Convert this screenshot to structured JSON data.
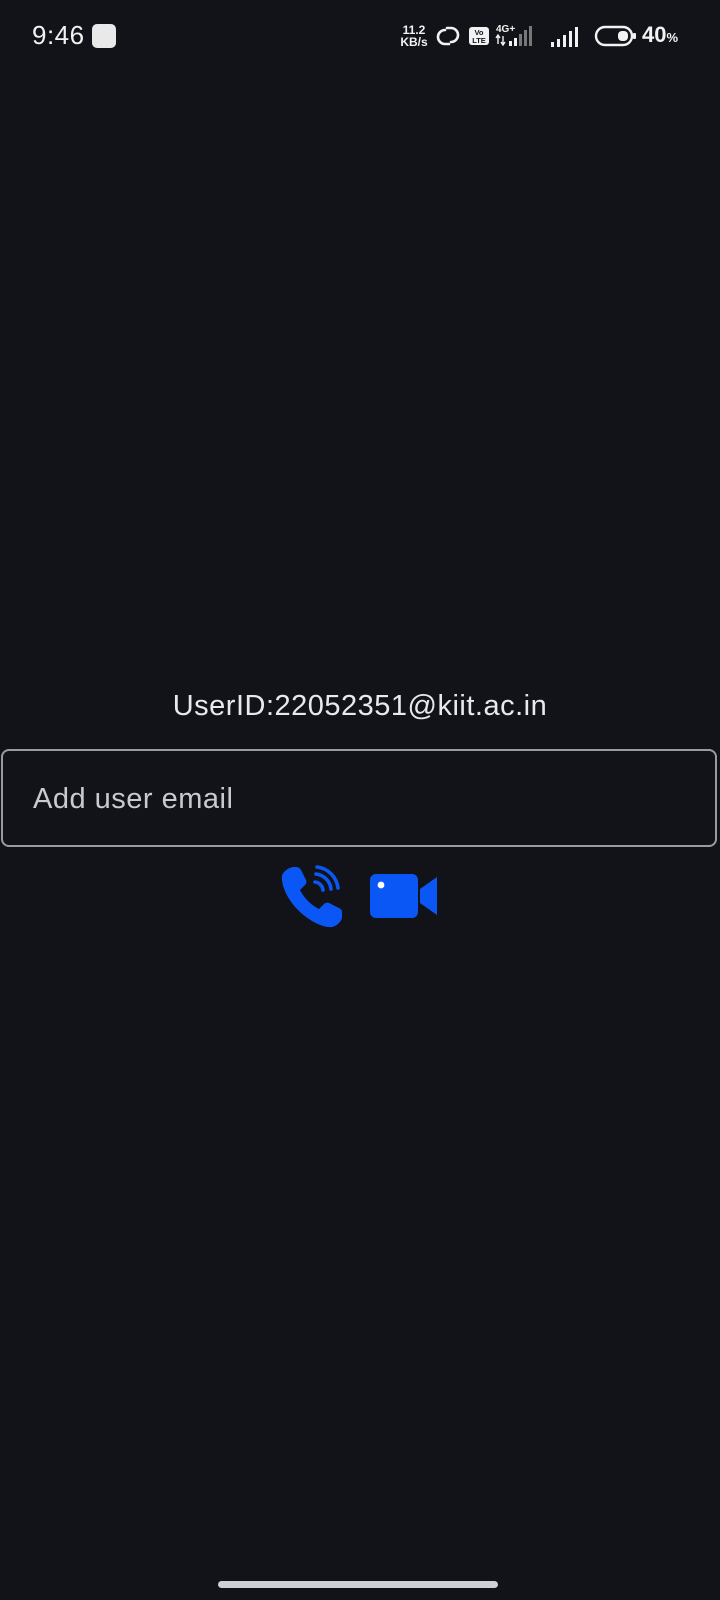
{
  "status_bar": {
    "time": "9:46",
    "net_speed_value": "11.2",
    "net_speed_unit": "KB/s",
    "volte_top": "Vo",
    "volte_bottom": "LTE",
    "network_type": "4G+",
    "battery_level": "40",
    "battery_unit": "%",
    "icons": [
      "notification-square-icon",
      "hotspot-link-icon",
      "volte-icon",
      "signal-sim1-icon",
      "signal-sim2-icon",
      "battery-icon"
    ]
  },
  "main": {
    "user_id": "UserID:22052351@kiit.ac.in",
    "email_input": {
      "placeholder": "Add user email",
      "value": ""
    },
    "actions": [
      "voice-call-icon",
      "video-call-icon"
    ]
  },
  "colors": {
    "background": "#121318",
    "accent": "#0b57f5",
    "text": "#e8e8ee",
    "border": "#9a9aa2"
  }
}
